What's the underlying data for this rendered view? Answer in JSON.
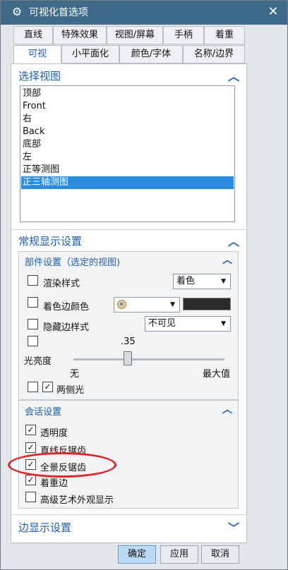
{
  "window": {
    "title": "可视化首选项",
    "title_icon": "gear-icon",
    "close": "✕"
  },
  "tabs_row1": [
    "直线",
    "特殊效果",
    "视图/屏幕",
    "手柄",
    "着重"
  ],
  "tabs_row2": [
    "可视",
    "小平面化",
    "颜色/字体",
    "名称/边界"
  ],
  "active_tab": "可视",
  "select_view": {
    "title": "选择视图",
    "items": [
      "顶部",
      "Front",
      "右",
      "Back",
      "底部",
      "左",
      "正等测图",
      "正三轴测图"
    ],
    "selected": "正三轴测图"
  },
  "general_display": {
    "title": "常规显示设置",
    "part_settings": {
      "title": "部件设置（选定的视图)",
      "render_style_label": "渲染样式",
      "render_style_value": "着色",
      "shaded_edge_color_label": "着色边颜色",
      "shaded_edge_color": "#2b2b2b",
      "hidden_edge_style_label": "隐藏边样式",
      "hidden_edge_style_value": "不可见",
      "brightness_label": "光亮度",
      "brightness_value": ".35",
      "brightness_min": "无",
      "brightness_max": "最大值",
      "two_sided_light_label": "两侧光",
      "two_sided_light": true
    },
    "session_settings": {
      "title": "会话设置",
      "transparency_label": "透明度",
      "transparency": true,
      "line_antialias_label": "直线反锯齿",
      "line_antialias": true,
      "full_scene_antialias_label": "全景反锯齿",
      "full_scene_antialias": true,
      "emphasis_edge_label": "着重边",
      "emphasis_edge": true,
      "advanced_art_label": "高级艺术外观显示",
      "advanced_art": false
    }
  },
  "edge_display": {
    "title": "边显示设置"
  },
  "buttons": {
    "ok": "确定",
    "apply": "应用",
    "cancel": "取消"
  },
  "colors": {
    "accent": "#1c5fb0",
    "title_bar": "#3f6a8a",
    "selection": "#2a8de0",
    "annotation": "#e02424"
  }
}
